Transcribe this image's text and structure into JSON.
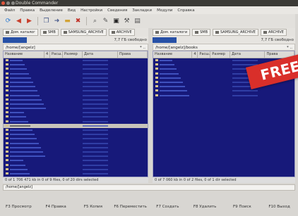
{
  "window": {
    "title": "Double Commander"
  },
  "menu": [
    "Файл",
    "Правка",
    "Выделение",
    "Вид",
    "Настройки",
    "Сведения",
    "Закладки",
    "Модули",
    "Справка"
  ],
  "toolbar": {
    "icons": [
      "refresh-icon",
      "back-icon",
      "forward-icon",
      "copy-icon",
      "move-icon",
      "mkdir-icon",
      "delete-icon",
      "search-icon",
      "edit-icon",
      "terminal-icon",
      "tools-icon",
      "archive-icon"
    ]
  },
  "left": {
    "drives": [
      "Дом. каталог",
      "SMB",
      "SAMSUNG_ARCHIVE",
      "ARCHIVE"
    ],
    "free": "7,7 ГБ свободно",
    "path": "/home/[angelz]",
    "controls": "*   ..",
    "columns": [
      "Название",
      "4",
      "Расш.",
      "Размер",
      "Дата",
      "Права"
    ],
    "status": "0 of 1 706 471 kb in 0 of 9 files, 0 of 20 dirs selected"
  },
  "right": {
    "drives": [
      "Дом. каталоги",
      "SMB",
      "SAMSUNG_ARCHIVE",
      "ARCHIVE"
    ],
    "free": "7,7 ГБ свободно",
    "path": "/home/[angelz]/books",
    "controls": "*   ..",
    "columns": [
      "Название",
      "4",
      "Расш.",
      "Размер",
      "Дата",
      "Права"
    ],
    "status": "0 of 7 060 kb in 0 of 2 files, 0 of 1 dir selected"
  },
  "cmdline": "/home/[angelz]",
  "fkeys": [
    "F3 Просмотр",
    "F4 Правка",
    "F5 Копия",
    "F6 Переместить",
    "F7 Создать",
    "F8 Удалить",
    "F9 Поиск",
    "F10 Выход"
  ],
  "banner": {
    "text": "FREE"
  },
  "colors": {
    "panel": "#17197a",
    "banner": "#d92f2a",
    "accent": "#2650a6"
  }
}
